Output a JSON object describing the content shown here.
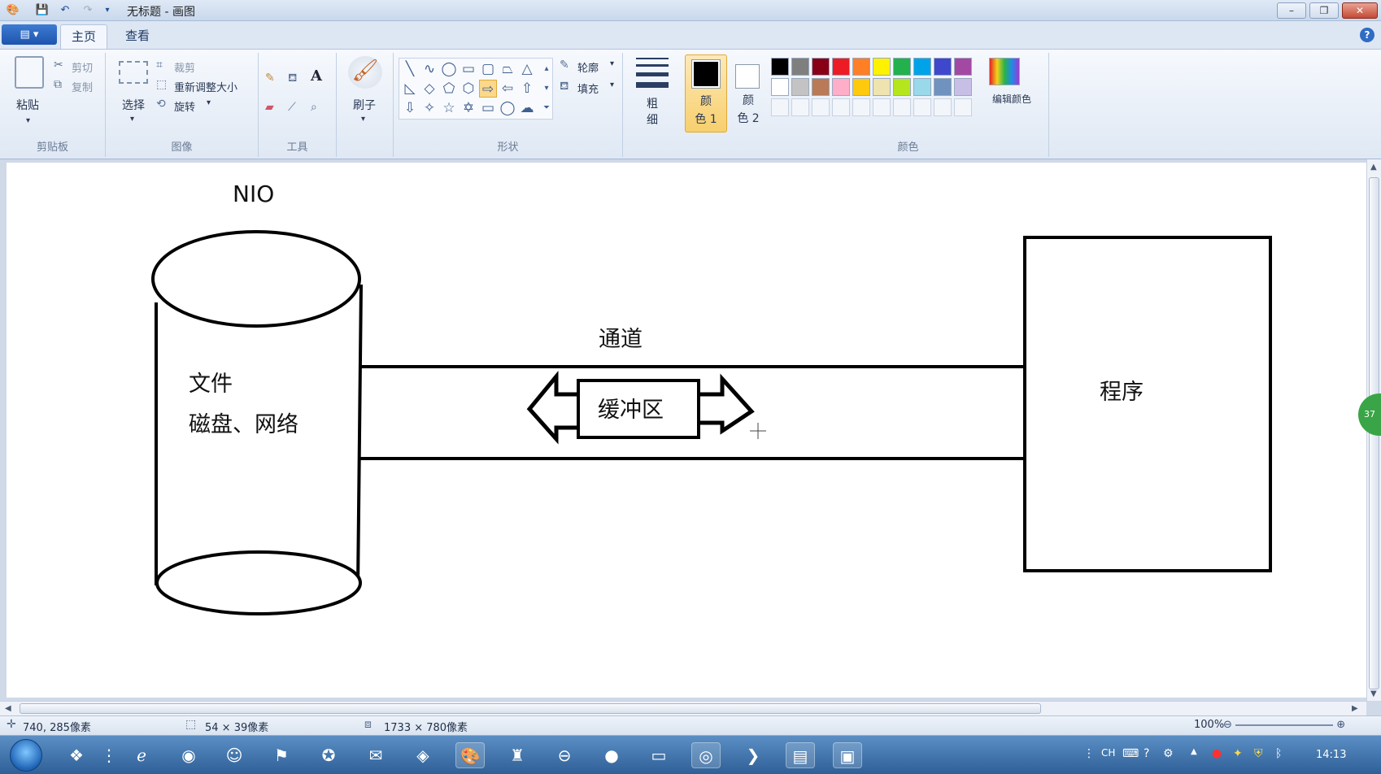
{
  "window": {
    "title": "无标题 - 画图",
    "minimize": "–",
    "restore": "❐",
    "close": "✕"
  },
  "quick_access": [
    "save-icon",
    "undo-icon",
    "redo-icon",
    "customize-icon"
  ],
  "tabs": {
    "file_menu": "▤ ▾",
    "home": "主页",
    "view": "查看"
  },
  "ribbon": {
    "clipboard": {
      "label": "剪贴板",
      "paste": "粘贴",
      "cut": "剪切",
      "copy": "复制"
    },
    "image": {
      "label": "图像",
      "select": "选择",
      "crop": "裁剪",
      "resize": "重新调整大小",
      "rotate": "旋转"
    },
    "tools": {
      "label": "工具",
      "text_icon": "A"
    },
    "brushes": {
      "label": "刷子"
    },
    "shapes": {
      "label": "形状",
      "outline": "轮廓",
      "fill": "填充"
    },
    "size": {
      "label_1": "粗",
      "label_2": "细"
    },
    "color1": {
      "label_1": "颜",
      "label_2": "色 1"
    },
    "color2": {
      "label_1": "颜",
      "label_2": "色 2"
    },
    "colors": {
      "label": "颜色",
      "edit": "编辑颜色",
      "row1": [
        "#000000",
        "#7f7f7f",
        "#880015",
        "#ed1c24",
        "#ff7f27",
        "#fff200",
        "#22b14c",
        "#00a2e8",
        "#3f48cc",
        "#a349a4"
      ],
      "row2": [
        "#ffffff",
        "#c3c3c3",
        "#b97a57",
        "#ffaec9",
        "#ffc90e",
        "#efe4b0",
        "#b5e61d",
        "#99d9ea",
        "#7092be",
        "#c8bfe7"
      ]
    }
  },
  "canvas": {
    "heading": "NIO",
    "file_line1": "文件",
    "file_line2": "磁盘、网络",
    "channel": "通道",
    "buffer": "缓冲区",
    "program": "程序"
  },
  "status": {
    "cursor": "740, 285像素",
    "selection": "54 × 39像素",
    "image_size": "1733 × 780像素",
    "zoom": "100%"
  },
  "side_badge": "37",
  "clock": "14:13",
  "tray_lang": "CH"
}
